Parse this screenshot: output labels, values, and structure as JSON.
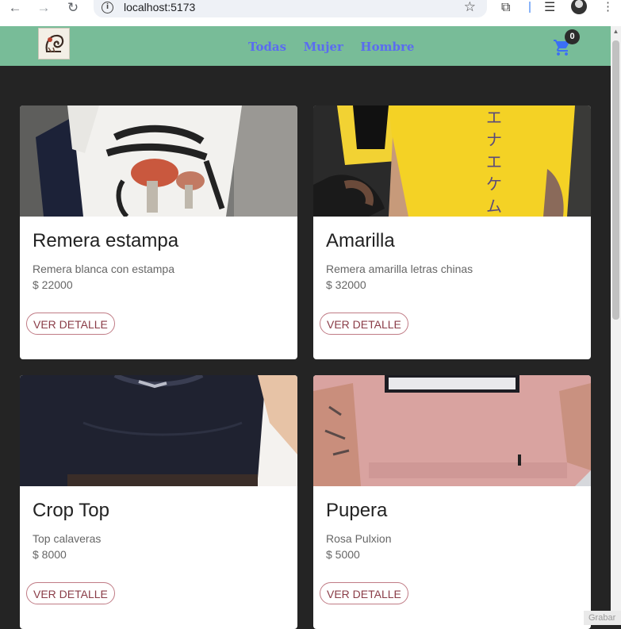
{
  "browser": {
    "url": "localhost:5173",
    "icons": [
      "back-icon",
      "forward-icon",
      "reload-icon",
      "info-icon",
      "star-icon",
      "extensions-icon",
      "reading-list-icon",
      "profile-avatar",
      "more-icon"
    ]
  },
  "navbar": {
    "bg_color": "#78bc98",
    "links": [
      "Todas",
      "Mujer",
      "Hombre"
    ],
    "cart_count": "0",
    "link_color": "#5b6cf0"
  },
  "products": [
    {
      "title": "Remera estampa",
      "description": "Remera blanca con estampa",
      "price": "$ 22000",
      "button": "VER DETALLE",
      "image": "white-printed-tshirt"
    },
    {
      "title": "Amarilla",
      "description": "Remera amarilla letras chinas",
      "price": "$ 32000",
      "button": "VER DETALLE",
      "image": "yellow-tshirt-chinese-letters"
    },
    {
      "title": "Crop Top",
      "description": "Top calaveras",
      "price": "$ 8000",
      "button": "VER DETALLE",
      "image": "black-crop-top"
    },
    {
      "title": "Pupera",
      "description": "Rosa Pulxion",
      "price": "$ 5000",
      "button": "VER DETALLE",
      "image": "pink-crop-pulxion"
    }
  ],
  "overlay": {
    "grabar": "Grabar"
  }
}
